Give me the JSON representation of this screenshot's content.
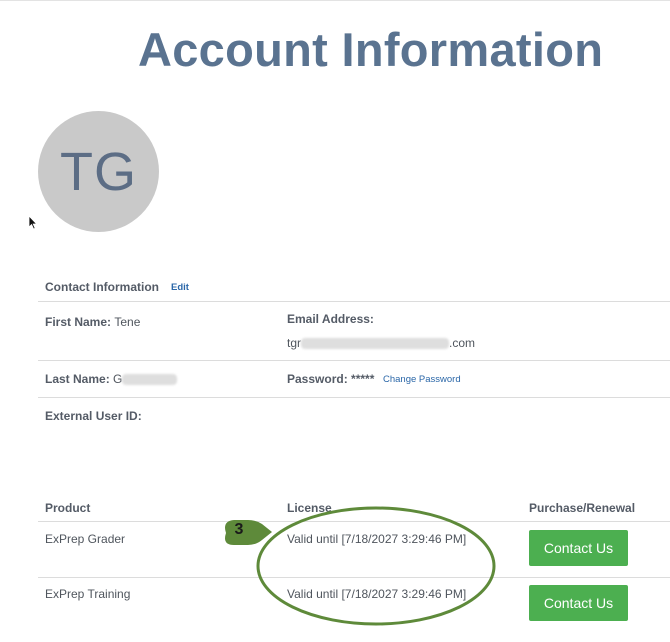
{
  "page": {
    "title": "Account Information"
  },
  "avatar": {
    "initials": "TG"
  },
  "contact": {
    "section_title": "Contact Information",
    "edit_label": "Edit",
    "first_name_label": "First Name:",
    "first_name_value": "Tene",
    "email_label": "Email Address:",
    "email_prefix": "tgr",
    "email_suffix": ".com",
    "last_name_label": "Last Name:",
    "last_name_initial": "G",
    "password_label": "Password:",
    "password_value": "*****",
    "change_password_label": "Change Password",
    "external_id_label": "External User ID:"
  },
  "products": {
    "headers": {
      "product": "Product",
      "license": "License",
      "purchase": "Purchase/Renewal"
    },
    "rows": [
      {
        "product": "ExPrep Grader",
        "license": "Valid until [7/18/2027 3:29:46 PM]",
        "action": "Contact Us"
      },
      {
        "product": "ExPrep Training",
        "license": "Valid until [7/18/2027 3:29:46 PM]",
        "action": "Contact Us"
      }
    ]
  },
  "annotation": {
    "number": "3",
    "color": "#5e8a3a"
  }
}
